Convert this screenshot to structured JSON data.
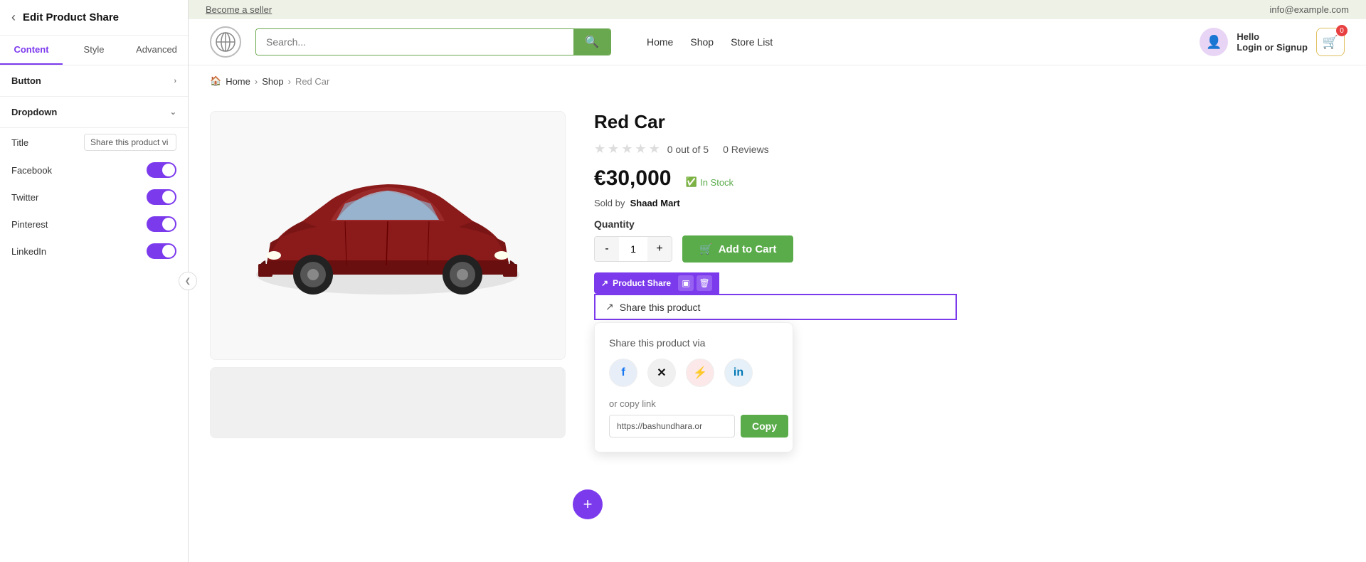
{
  "left_panel": {
    "title": "Edit Product Share",
    "tabs": [
      {
        "id": "content",
        "label": "Content",
        "active": true
      },
      {
        "id": "style",
        "label": "Style",
        "active": false
      },
      {
        "id": "advanced",
        "label": "Advanced",
        "active": false
      }
    ],
    "sections": {
      "button": {
        "label": "Button",
        "collapsed": false
      },
      "dropdown": {
        "label": "Dropdown",
        "collapsed": false
      }
    },
    "fields": {
      "title_label": "Title",
      "title_value": "Share this product vi",
      "facebook_label": "Facebook",
      "facebook_on": true,
      "twitter_label": "Twitter",
      "twitter_on": true,
      "pinterest_label": "Pinterest",
      "pinterest_on": true,
      "linkedin_label": "LinkedIn",
      "linkedin_on": true
    }
  },
  "topbar": {
    "become_seller": "Become a seller",
    "email": "info@example.com"
  },
  "header": {
    "search_placeholder": "Search...",
    "nav": [
      "Home",
      "Shop",
      "Store List"
    ],
    "user_greeting": "Hello",
    "user_action": "Login or Signup",
    "cart_count": "0"
  },
  "breadcrumb": {
    "home": "Home",
    "shop": "Shop",
    "current": "Red Car"
  },
  "product": {
    "name": "Red Car",
    "rating_text": "0 out of 5",
    "review_count": "0  Reviews",
    "price": "€30,000",
    "in_stock": "In Stock",
    "sold_by_label": "Sold by",
    "seller": "Shaad Mart",
    "quantity_label": "Quantity",
    "qty_minus": "-",
    "qty_value": "1",
    "qty_plus": "+",
    "add_to_cart": "Add to Cart",
    "share_tag": "Product Share",
    "share_this": "Share this product",
    "share_via": "Share this product via",
    "copy_link_label": "or copy link",
    "copy_link_url": "https://bashundhara.or",
    "copy_btn": "Copy"
  }
}
